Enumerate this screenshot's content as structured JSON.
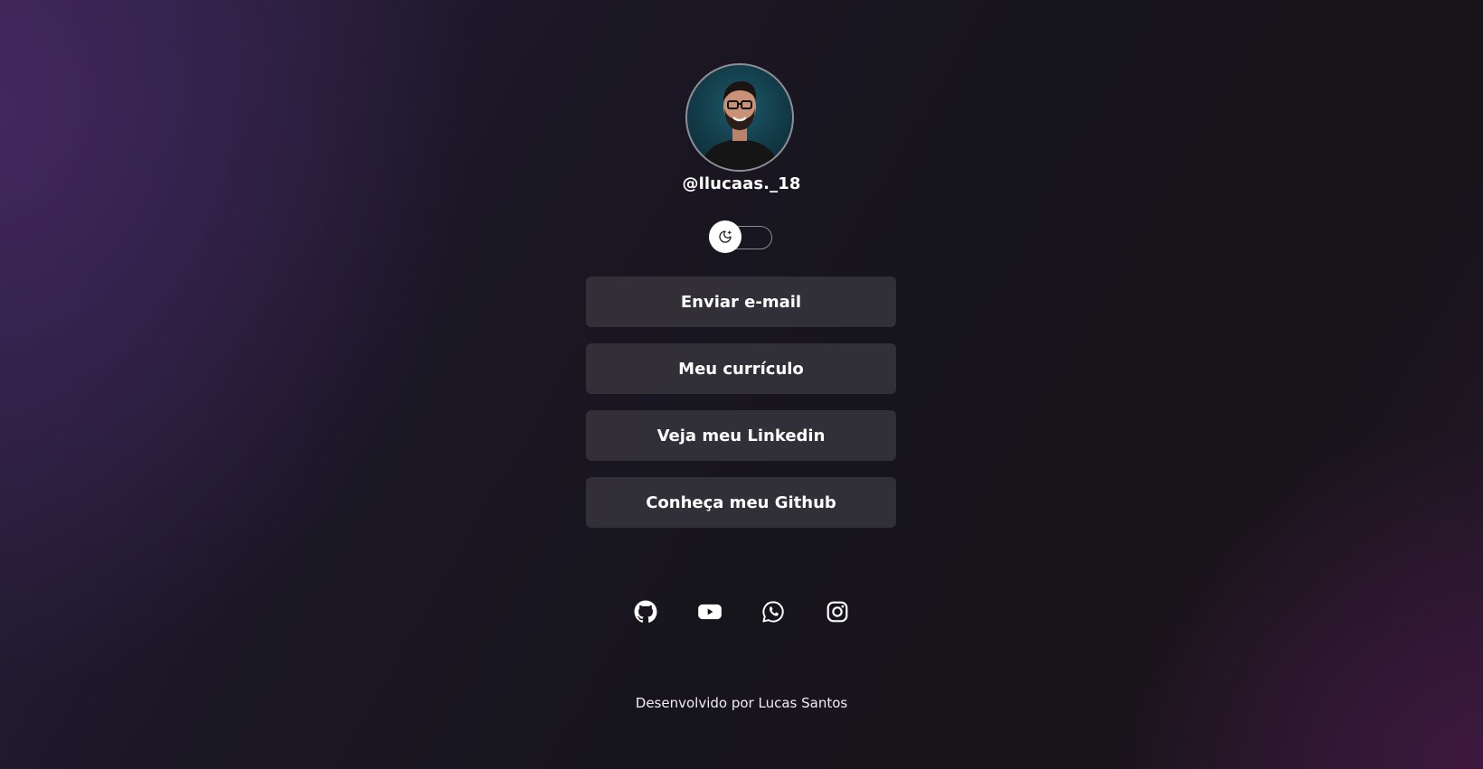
{
  "profile": {
    "handle": "@llucaas._18"
  },
  "theme_toggle": {
    "icon": "moon-stars-icon",
    "state": "dark"
  },
  "links": [
    {
      "label": "Enviar e-mail"
    },
    {
      "label": "Meu currículo"
    },
    {
      "label": "Veja meu Linkedin"
    },
    {
      "label": "Conheça meu Github"
    }
  ],
  "socials": [
    {
      "icon": "github-icon"
    },
    {
      "icon": "youtube-icon"
    },
    {
      "icon": "whatsapp-icon"
    },
    {
      "icon": "instagram-icon"
    }
  ],
  "footer": {
    "text": "Desenvolvido por Lucas Santos"
  },
  "colors": {
    "button_bg": "#34323a",
    "text": "#ffffff",
    "accent_purple": "#46286a"
  }
}
